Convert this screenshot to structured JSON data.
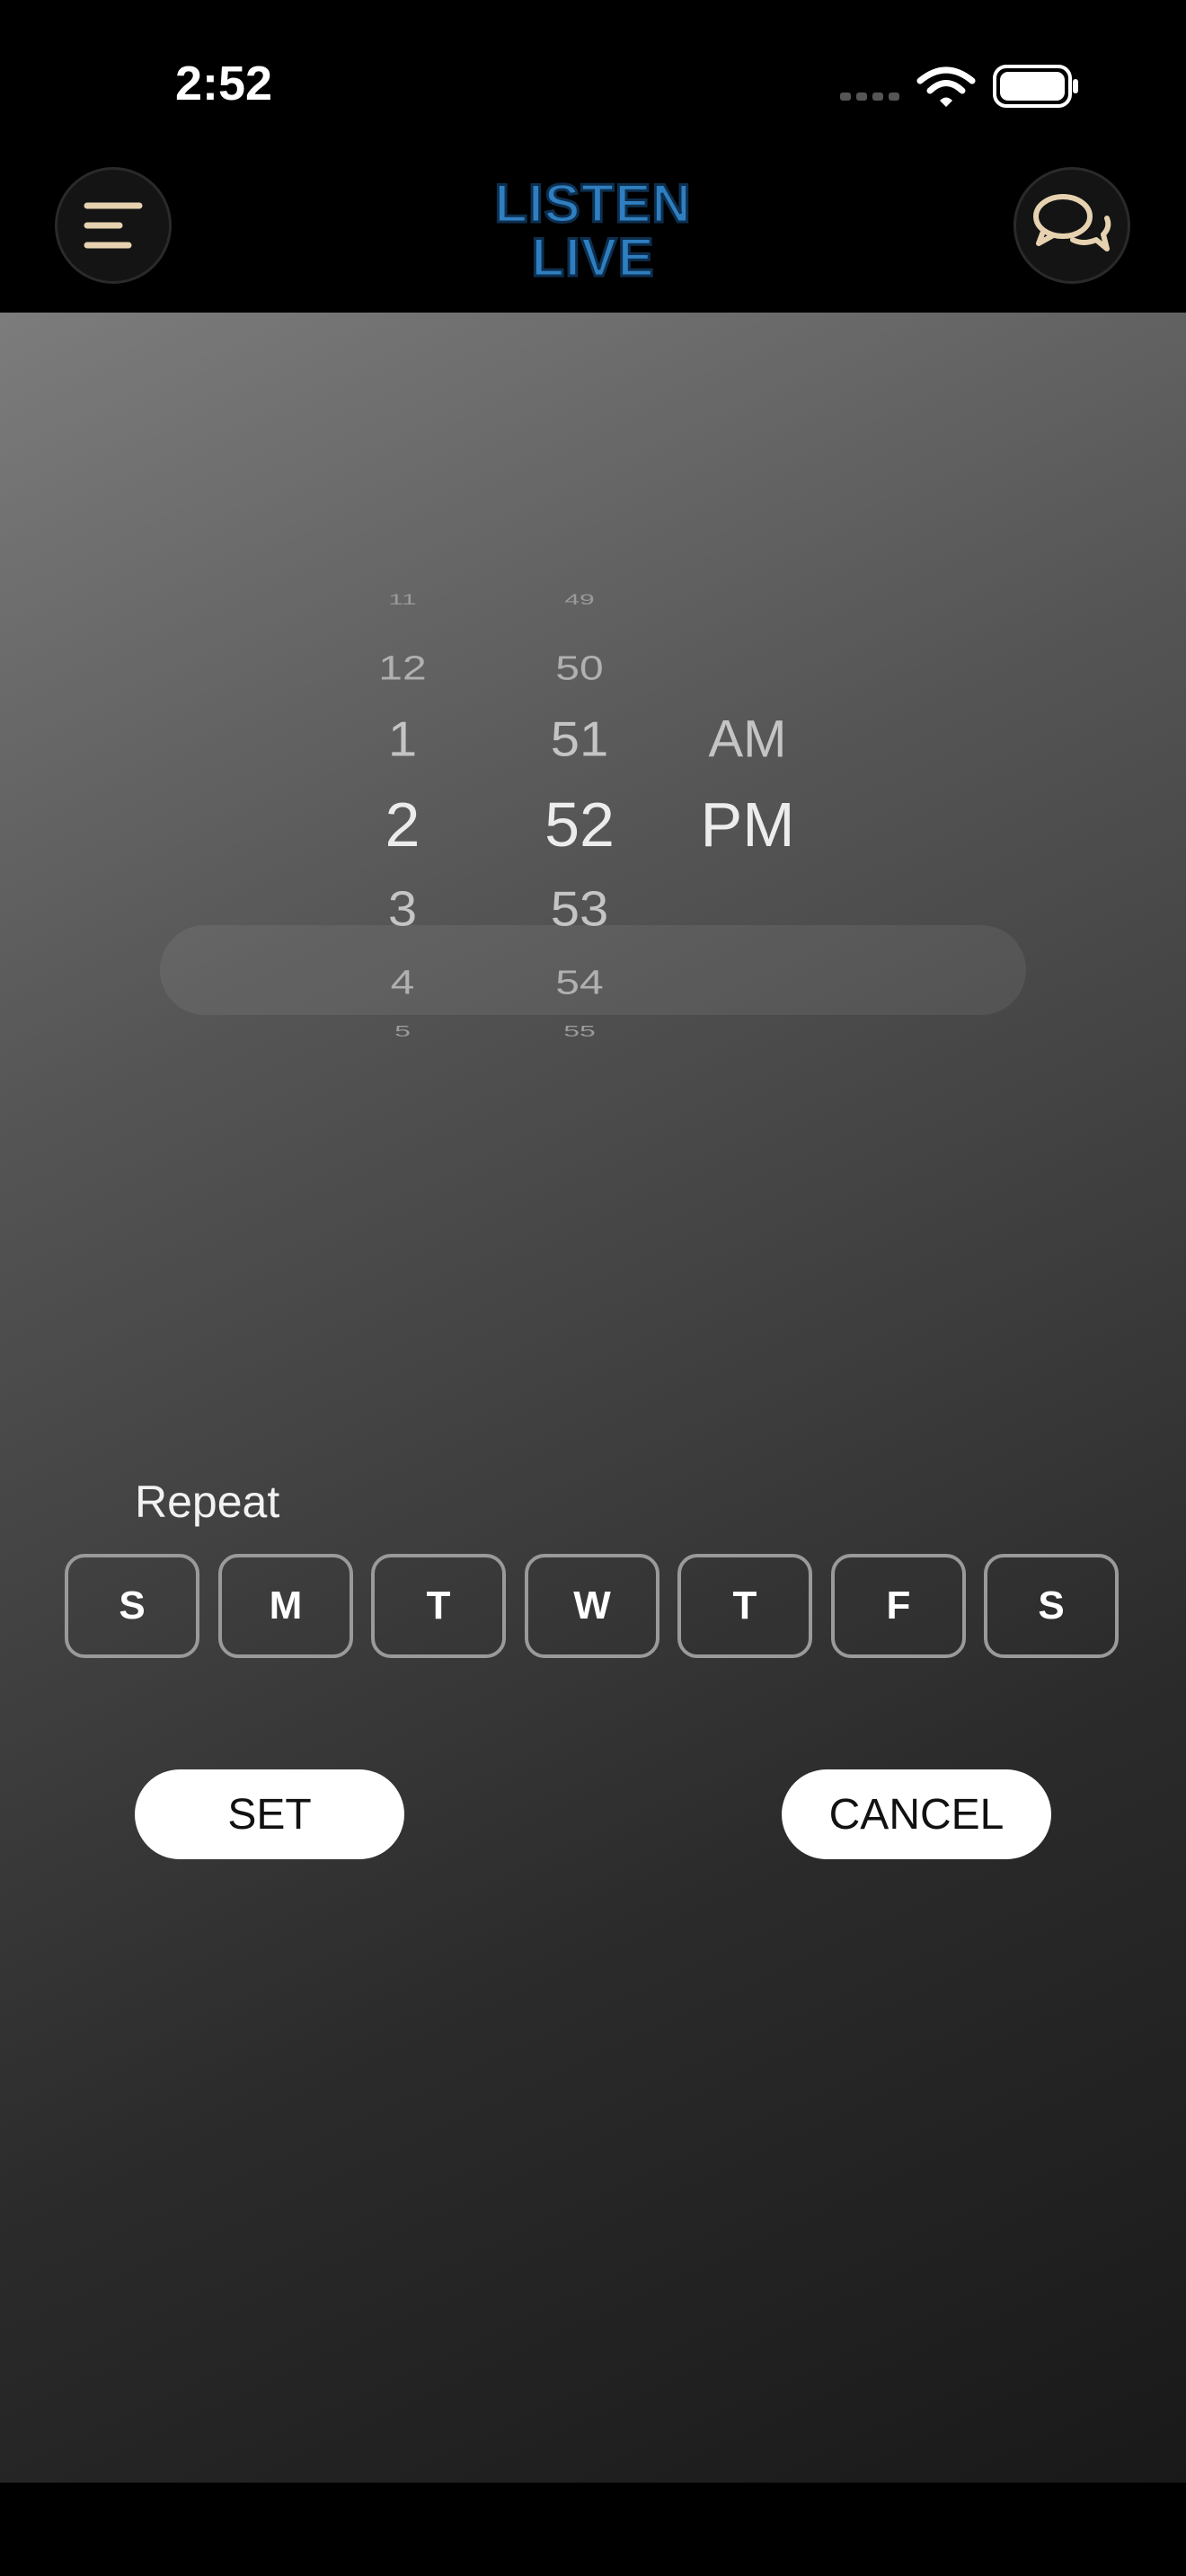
{
  "status_bar": {
    "time": "2:52"
  },
  "header": {
    "logo_line1": "LISTEN",
    "logo_line2": "LIVE",
    "menu_icon": "menu-icon",
    "chat_icon": "chat-bubbles-icon",
    "logo_color": "#2f7fc0",
    "icon_color": "#e6d2b0"
  },
  "picker": {
    "hours": [
      "11",
      "12",
      "1",
      "2",
      "3",
      "4",
      "5"
    ],
    "minutes": [
      "49",
      "50",
      "51",
      "52",
      "53",
      "54",
      "55"
    ],
    "periods": [
      "AM",
      "PM"
    ],
    "selected": {
      "hour": "2",
      "minute": "52",
      "period": "PM"
    }
  },
  "repeat": {
    "label": "Repeat",
    "days": [
      "S",
      "M",
      "T",
      "W",
      "T",
      "F",
      "S"
    ]
  },
  "actions": {
    "set_label": "SET",
    "cancel_label": "CANCEL"
  }
}
